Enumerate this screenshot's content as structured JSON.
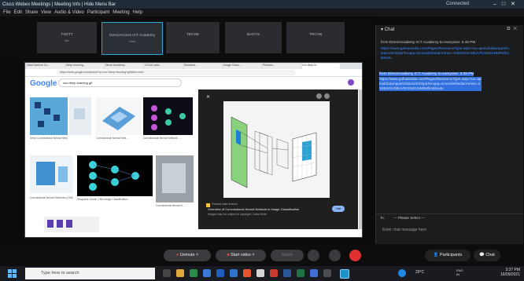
{
  "window": {
    "title": "Cisco Webex Meetings  |  Meeting Info  |  Hide Menu Bar",
    "status": "Connected",
    "controls": [
      "–",
      "□",
      "✕"
    ]
  },
  "menu": [
    "File",
    "Edit",
    "Share",
    "View",
    "Audio & Video",
    "Participant",
    "Meeting",
    "Help"
  ],
  "participants": [
    {
      "name": "TSDTT",
      "sub": "Me"
    },
    {
      "name": "DirectAccess ICT Academy",
      "sub": "Host"
    },
    {
      "name": "TECSE",
      "sub": ""
    },
    {
      "name": "BADYS",
      "sub": ""
    },
    {
      "name": "TRCVB",
      "sub": ""
    }
  ],
  "browser": {
    "tabs": [
      "Data Science Co...",
      "Deep learning...",
      "Direct Academy...",
      "CCNA Labs...",
      "Sessions...",
      "Image Class...",
      "Pictures...",
      "cnn deep le..."
    ],
    "url": "https://www.google.com/search?q=cnn+deep+learning+gif&tbm=isch",
    "search_query": "cnn deep learning gif",
    "google": "Google",
    "result_captions": [
      "Deep Convolutional Neural Networks (NN...",
      "Convolutional Neural Nets ...",
      "Convolutional Neural Network - ...",
      "Convolutional Neural Networks (CNN)...",
      "Response Guide: CNN Image Classification...",
      "Convolutional Neural N..."
    ],
    "viewer_source": "Towards Data Science",
    "viewer_title": "Overview of Convolutional Neural Network in Image Classification",
    "viewer_note": "Images may be subject to copyright. Learn More",
    "visit_label": "Visit"
  },
  "chat": {
    "title": "Chat",
    "header_icons": [
      "⧉",
      "✕"
    ],
    "msg1_from": "from DirectAcademy ICT Academy to everyone:",
    "msg1_time": "2:43 PM",
    "msg1_body": "https://www.gafoasindia.com/Pages/ResourceType.aspx?ux=aptoul/dataApps/InstanceEntity&Tenapp=scnsv/default&Yomen=3XMUK5V2BUVRJSNS1NMRsfkABzw4u",
    "msg2_from": "from DirectAcademy ICT Academy to everyone:",
    "msg2_time": "3:08 PM",
    "msg2_body": "https://www.gafoasindia.com/Pages/ResourceType.aspx?ux=aptoul/dataApps/InstanceEntity&Tenapp=scnsv/default&Yomen=3XMUK5V2BUVRJSNS1NMRsfkABzw4u",
    "to_label": "To:",
    "to_value": "Please Select",
    "input_placeholder": "Enter chat message here"
  },
  "controls": {
    "unmute": "Unmute",
    "start_video": "Start video",
    "share": "Share",
    "participants": "Participants",
    "chat": "Chat"
  },
  "taskbar": {
    "search_placeholder": "Type here to search",
    "weather": "29°C",
    "lang": "ENG\nIN",
    "time": "3:37 PM",
    "date": "16/09/2021"
  }
}
